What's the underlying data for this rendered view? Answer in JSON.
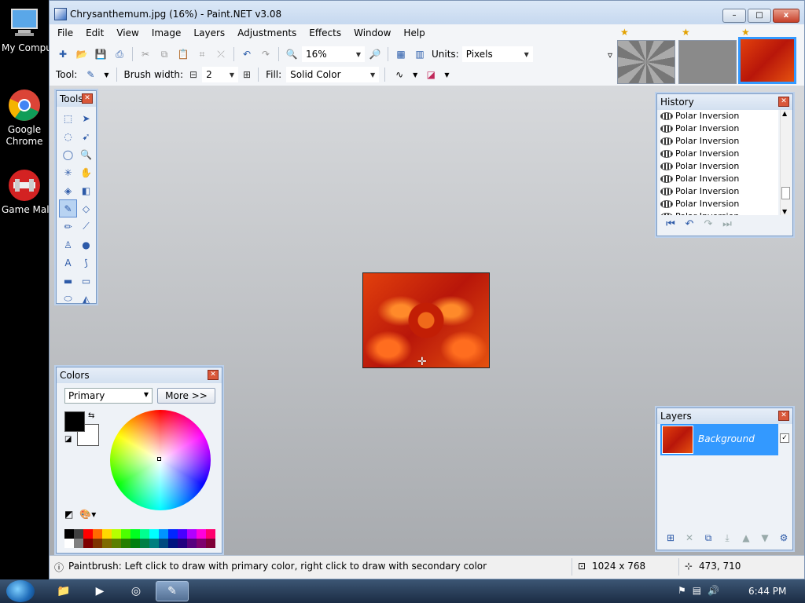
{
  "desktop": {
    "icons": [
      {
        "label": "My Compu",
        "icon": "computer-icon"
      },
      {
        "label": "Google Chrome",
        "line1": "Google",
        "line2": "Chrome",
        "icon": "chrome-icon"
      },
      {
        "label": "Game Mal",
        "icon": "game-maker-icon"
      }
    ]
  },
  "window": {
    "title": "Chrysanthemum.jpg (16%) - Paint.NET v3.08",
    "controls": {
      "minimize": "–",
      "maximize": "□",
      "close": "x"
    }
  },
  "menu": [
    "File",
    "Edit",
    "View",
    "Image",
    "Layers",
    "Adjustments",
    "Effects",
    "Window",
    "Help"
  ],
  "toolbar": {
    "zoom_value": "16%",
    "units_label": "Units:",
    "units_value": "Pixels"
  },
  "toolbar2": {
    "tool_label": "Tool:",
    "brush_width_label": "Brush width:",
    "brush_width_value": "2",
    "fill_label": "Fill:",
    "fill_value": "Solid Color"
  },
  "tools_panel": {
    "title": "Tools",
    "items": [
      {
        "icon": "rectangle-select-icon",
        "glyph": "⬚"
      },
      {
        "icon": "move-selection-icon",
        "glyph": "➤"
      },
      {
        "icon": "lasso-select-icon",
        "glyph": "◌"
      },
      {
        "icon": "move-selected-icon",
        "glyph": "➹"
      },
      {
        "icon": "ellipse-select-icon",
        "glyph": "◯"
      },
      {
        "icon": "zoom-icon",
        "glyph": "🔍"
      },
      {
        "icon": "magic-wand-icon",
        "glyph": "✳"
      },
      {
        "icon": "pan-icon",
        "glyph": "✋"
      },
      {
        "icon": "paint-bucket-icon",
        "glyph": "◈"
      },
      {
        "icon": "gradient-icon",
        "glyph": "◧"
      },
      {
        "icon": "paintbrush-icon",
        "glyph": "✎",
        "active": true
      },
      {
        "icon": "eraser-icon",
        "glyph": "◇"
      },
      {
        "icon": "pencil-icon",
        "glyph": "✏"
      },
      {
        "icon": "color-picker-icon",
        "glyph": "⟋"
      },
      {
        "icon": "clone-stamp-icon",
        "glyph": "♙"
      },
      {
        "icon": "recolor-icon",
        "glyph": "●"
      },
      {
        "icon": "text-icon",
        "glyph": "A"
      },
      {
        "icon": "line-curve-icon",
        "glyph": "⟆"
      },
      {
        "icon": "rectangle-icon",
        "glyph": "▬"
      },
      {
        "icon": "rounded-rectangle-icon",
        "glyph": "▭"
      },
      {
        "icon": "ellipse-icon",
        "glyph": "⬭"
      },
      {
        "icon": "freeform-shape-icon",
        "glyph": "◭"
      }
    ]
  },
  "history": {
    "title": "History",
    "items": [
      "Polar Inversion",
      "Polar Inversion",
      "Polar Inversion",
      "Polar Inversion",
      "Polar Inversion",
      "Polar Inversion",
      "Polar Inversion",
      "Polar Inversion",
      "Polar Inversion"
    ]
  },
  "colors": {
    "title": "Colors",
    "selector_value": "Primary",
    "more_label": "More >>",
    "primary_color": "#000000",
    "secondary_color": "#ffffff",
    "palette": [
      "#000000",
      "#404040",
      "#ff0000",
      "#ff6a00",
      "#ffd800",
      "#b6ff00",
      "#4cff00",
      "#00ff21",
      "#00ff90",
      "#00ffff",
      "#0094ff",
      "#0026ff",
      "#4800ff",
      "#b200ff",
      "#ff00dc",
      "#ff006e",
      "#ffffff",
      "#808080",
      "#7f0000",
      "#7f3300",
      "#7f6a00",
      "#5b7f00",
      "#267f00",
      "#007f0e",
      "#007f46",
      "#007f7f",
      "#004a7f",
      "#00137f",
      "#21007f",
      "#57007f",
      "#7f006e",
      "#7f0037"
    ]
  },
  "layers": {
    "title": "Layers",
    "items": [
      {
        "name": "Background",
        "visible": true
      }
    ]
  },
  "status": {
    "hint": "Paintbrush: Left click to draw with primary color, right click to draw with secondary color",
    "image_size": "1024 x 768",
    "cursor_pos": "473, 710"
  },
  "taskbar": {
    "time": "6:44 PM"
  }
}
